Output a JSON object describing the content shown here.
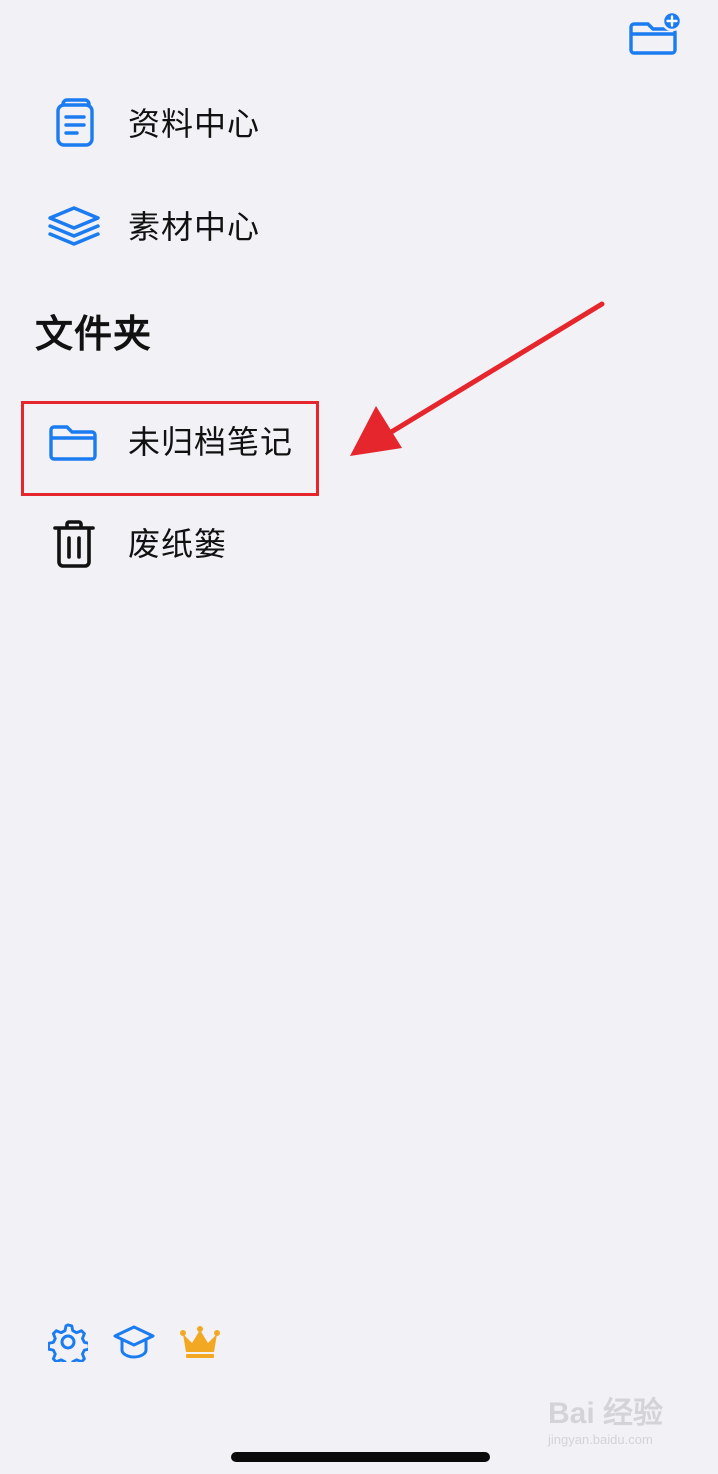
{
  "header": {
    "new_folder_icon": "folder-plus-icon",
    "accent_color": "#1a7cf0"
  },
  "nav": {
    "items": [
      {
        "label": "资料中心",
        "icon": "notebook-icon"
      },
      {
        "label": "素材中心",
        "icon": "layers-icon"
      }
    ]
  },
  "folders_section": {
    "title": "文件夹",
    "items": [
      {
        "label": "未归档笔记",
        "icon": "folder-icon"
      },
      {
        "label": "废纸篓",
        "icon": "trash-icon"
      }
    ]
  },
  "annotation": {
    "highlight_color": "#e5262c",
    "arrow_color": "#e5262c"
  },
  "bottom_bar": {
    "icons": [
      "gear-icon",
      "graduation-cap-icon",
      "crown-icon"
    ],
    "crown_color": "#f3a823"
  },
  "watermark": {
    "main": "Bai 经验",
    "sub": "jingyan.baidu.com"
  }
}
